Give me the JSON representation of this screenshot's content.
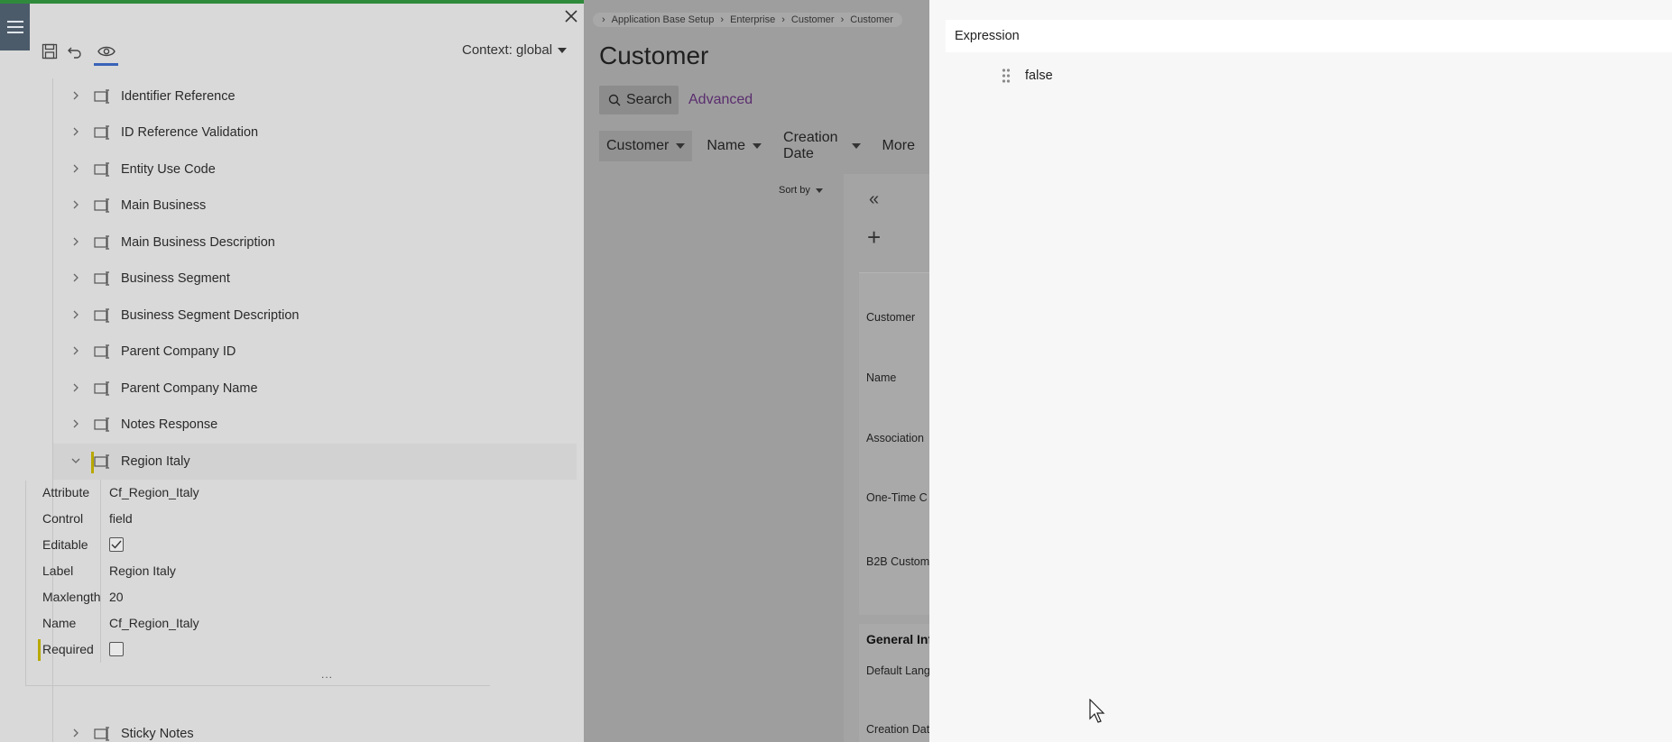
{
  "designer": {
    "context_label": "Context: global",
    "tree": [
      {
        "label": "Identifier Reference"
      },
      {
        "label": "ID Reference Validation"
      },
      {
        "label": "Entity Use Code"
      },
      {
        "label": "Main Business"
      },
      {
        "label": "Main Business Description"
      },
      {
        "label": "Business Segment"
      },
      {
        "label": "Business Segment Description"
      },
      {
        "label": "Parent Company ID"
      },
      {
        "label": "Parent Company Name"
      },
      {
        "label": "Notes Response"
      },
      {
        "label": "Region Italy",
        "expanded": true,
        "selected": true
      },
      {
        "label": "Sticky Notes"
      }
    ],
    "properties": {
      "attribute": {
        "key": "Attribute",
        "value": "Cf_Region_Italy"
      },
      "control": {
        "key": "Control",
        "value": "field"
      },
      "editable": {
        "key": "Editable",
        "checked": true
      },
      "label": {
        "key": "Label",
        "value": "Region Italy"
      },
      "maxlength": {
        "key": "Maxlength",
        "value": "20"
      },
      "name": {
        "key": "Name",
        "value": "Cf_Region_Italy"
      },
      "required": {
        "key": "Required",
        "checked": false
      }
    },
    "more": "..."
  },
  "app": {
    "breadcrumbs": [
      "Application Base Setup",
      "Enterprise",
      "Customer",
      "Customer"
    ],
    "title": "Customer",
    "search_label": "Search",
    "advanced_label": "Advanced",
    "filters": [
      "Customer",
      "Name",
      "Creation Date",
      "More"
    ],
    "sort_label": "Sort by",
    "card_fields": [
      "Customer",
      "Name",
      "Association",
      "One-Time C",
      "B2B Custom"
    ],
    "section_title": "General Inf",
    "section_fields": [
      "Default Lang",
      "Creation Dat"
    ]
  },
  "expression": {
    "header": "Expression",
    "value": "false"
  },
  "colors": {
    "accent_green": "#2f8a3c",
    "selection_marker": "#b8a800",
    "tab_underline": "#3a63b8",
    "link_purple": "#5a2d6e"
  }
}
